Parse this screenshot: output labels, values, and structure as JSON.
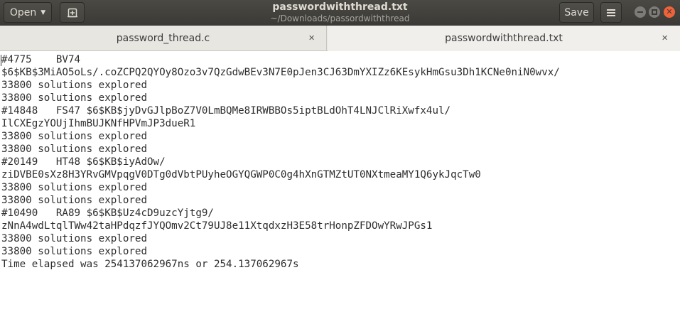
{
  "header": {
    "open_label": "Open",
    "title": "passwordwiththread.txt",
    "subtitle": "~/Downloads/passordwiththread",
    "save_label": "Save",
    "icons": [
      "new-document-icon",
      "hamburger-menu-icon",
      "minimize-icon",
      "maximize-icon",
      "close-icon"
    ]
  },
  "tabs": [
    {
      "label": "password_thread.c",
      "active": false
    },
    {
      "label": "passwordwiththread.txt",
      "active": true
    }
  ],
  "editor": {
    "lines": [
      "#4775    BV74",
      "$6$KB$3MiAO5oLs/.coZCPQ2QYOy8Ozo3v7QzGdwBEv3N7E0pJen3CJ63DmYXIZz6KEsykHmGsu3Dh1KCNe0niN0wvx/",
      "33800 solutions explored",
      "33800 solutions explored",
      "#14848   FS47 $6$KB$jyDvGJlpBoZ7V0LmBQMe8IRWBBOs5iptBLdOhT4LNJClRiXwfx4ul/",
      "IlCXEgzYOUjIhmBUJKNfHPVmJP3dueR1",
      "33800 solutions explored",
      "33800 solutions explored",
      "#20149   HT48 $6$KB$iyAdOw/",
      "ziDVBE0sXz8H3YRvGMVpqgV0DTg0dVbtPUyheOGYQGWP0C0g4hXnGTMZtUT0NXtmeaMY1Q6ykJqcTw0",
      "33800 solutions explored",
      "33800 solutions explored",
      "#10490   RA89 $6$KB$Uz4cD9uzcYjtg9/",
      "zNnA4wdLtqlTWw42taHPdqzfJYQOmv2Ct79UJ8e11XtqdxzH3E58trHonpZFDOwYRwJPGs1",
      "33800 solutions explored",
      "33800 solutions explored",
      "Time elapsed was 254137062967ns or 254.137062967s"
    ]
  }
}
